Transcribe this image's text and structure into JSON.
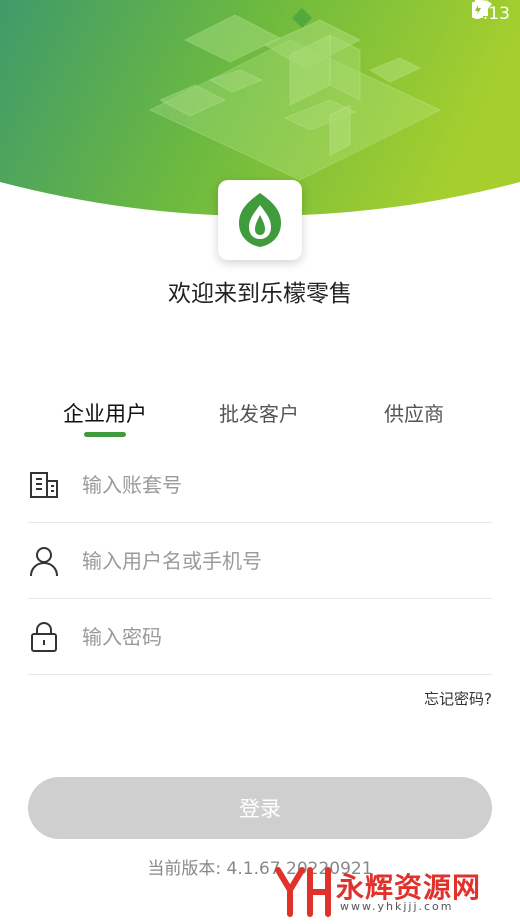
{
  "status_bar": {
    "time": "8:13"
  },
  "welcome_text": "欢迎来到乐檬零售",
  "tabs": [
    {
      "label": "企业用户",
      "active": true
    },
    {
      "label": "批发客户",
      "active": false
    },
    {
      "label": "供应商",
      "active": false
    }
  ],
  "fields": {
    "account": {
      "placeholder": "输入账套号",
      "icon": "building-icon"
    },
    "username": {
      "placeholder": "输入用户名或手机号",
      "icon": "user-icon"
    },
    "password": {
      "placeholder": "输入密码",
      "icon": "lock-icon"
    }
  },
  "forgot_password": "忘记密码?",
  "login_button": "登录",
  "version_text": "当前版本: 4.1.67 20220921",
  "watermark": {
    "title": "永辉资源网",
    "url": "www.yhkjjj.com"
  },
  "colors": {
    "brand_green": "#3f9b3c",
    "button_disabled": "#cfcfcf"
  }
}
